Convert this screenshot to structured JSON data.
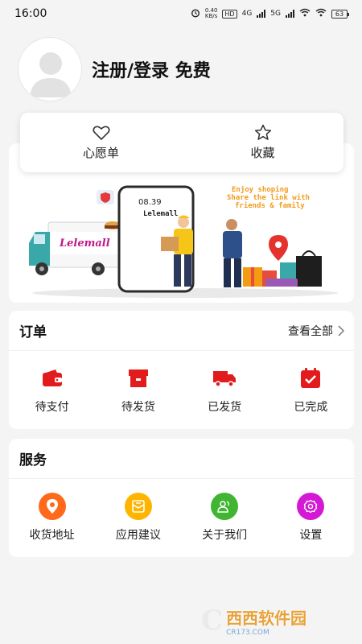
{
  "status_bar": {
    "time": "16:00",
    "net_speed_value": "0.40",
    "net_speed_unit": "KB/s",
    "hd_label": "HD",
    "signal_4g": "4G",
    "signal_5g": "5G",
    "battery": "63"
  },
  "profile": {
    "login_text": "注册/登录 免费"
  },
  "favorites": {
    "wishlist_label": "心愿单",
    "collect_label": "收藏"
  },
  "banner": {
    "line1": "Enjoy shoping",
    "line2": "Share the link with",
    "line3": "friends & family",
    "brand": "Lelemall",
    "phone_time": "08.39",
    "truck_brand": "Lelemall"
  },
  "orders": {
    "title": "订单",
    "view_all": "查看全部",
    "items": [
      {
        "label": "待支付",
        "icon": "wallet-icon"
      },
      {
        "label": "待发货",
        "icon": "package-icon"
      },
      {
        "label": "已发货",
        "icon": "truck-icon"
      },
      {
        "label": "已完成",
        "icon": "check-box-icon"
      }
    ]
  },
  "services": {
    "title": "服务",
    "items": [
      {
        "label": "收货地址",
        "icon": "location-icon",
        "color": "#ff6a1a"
      },
      {
        "label": "应用建议",
        "icon": "feedback-icon",
        "color": "#ffb400"
      },
      {
        "label": "关于我们",
        "icon": "people-icon",
        "color": "#3fb531"
      },
      {
        "label": "设置",
        "icon": "gear-icon",
        "color": "#d419d4"
      }
    ]
  },
  "watermark": {
    "letter": "C",
    "text": "西西软件园",
    "sub": "CR173.COM"
  },
  "colors": {
    "accent_red": "#e21c1c",
    "background": "#f4f4f4"
  }
}
